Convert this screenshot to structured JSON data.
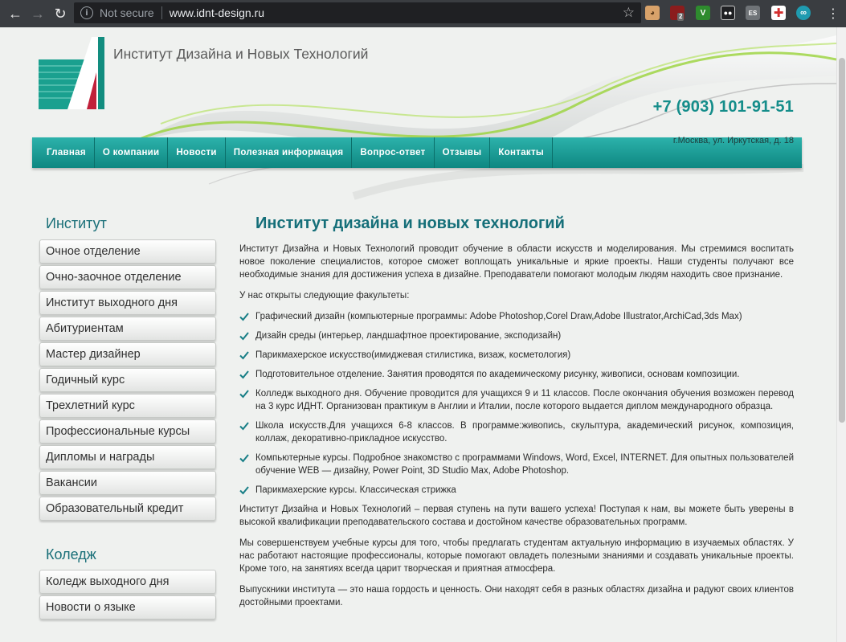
{
  "browser": {
    "security_label": "Not secure",
    "url": "www.idnt-design.ru",
    "badge_count": "2",
    "ext_v_label": "V",
    "ext_es_label": "ES"
  },
  "header": {
    "site_title": "Институт Дизайна и Новых Технологий",
    "phone": "+7 (903) 101-91-51",
    "address": "г.Москва, ул. Иркутская, д. 18"
  },
  "nav": {
    "items": [
      "Главная",
      "О компании",
      "Новости",
      "Полезная информация",
      "Вопрос-ответ",
      "Отзывы",
      "Контакты"
    ]
  },
  "sidebar": {
    "institute_heading": "Институт",
    "institute_items": [
      "Очное отделение",
      "Очно-заочное отделение",
      "Институт выходного дня",
      "Абитуриентам",
      "Мастер дизайнер",
      "Годичный курс",
      "Трехлетний курс",
      "Профессиональные курсы",
      "Дипломы и награды",
      "Вакансии",
      "Образовательный кредит"
    ],
    "college_heading": "Коледж",
    "college_items": [
      "Коледж выходного дня",
      "Новости о языке"
    ]
  },
  "content": {
    "title": "Институт дизайна и новых технологий",
    "intro": "Институт Дизайна и Новых Технологий проводит обучение в области искусств и моделирования. Мы стремимся воспитать новое поколение специалистов, которое сможет воплощать уникальные и яркие проекты. Наши студенты получают все необходимые знания для достижения успеха в дизайне. Преподаватели помогают молодым людям находить свое признание.",
    "faculties_intro": "У нас открыты следующие факультеты:",
    "faculties": [
      "Графический дизайн (компьютерные программы: Adobe Photoshop,Corel Draw,Adobe Illustrator,ArchiCad,3ds Max)",
      "Дизайн среды (интерьер, ландшафтное проектирование, эксподизайн)",
      "Парикмахерское искусство(имиджевая стилистика, визаж, косметология)",
      "Подготовительное отделение. Занятия проводятся по академическому рисунку, живописи, основам композиции.",
      "Колледж выходного дня. Обучение проводится для учащихся 9 и 11 классов. После окончания обучения возможен перевод на 3 курс ИДНТ. Организован практикум в Англии и Италии, после которого выдается диплом международного образца.",
      "Школа искусств.Для учащихся 6-8 классов. В программе:живопись, скульптура, академический рисунок, композиция, коллаж, декоративно-прикладное искусство.",
      "Компьютерные курсы. Подробное знакомство с программами Windows, Word, Excel, INTERNET. Для опытных пользователей обучение WEB — дизайну, Power Point, 3D Studio Max, Adobe Photoshop.",
      "Парикмахерские курсы. Классическая стрижка"
    ],
    "paragraph_1": "Институт Дизайна и Новых Технологий – первая ступень на пути вашего успеха! Поступая к нам, вы можете быть уверены в высокой квалификации преподавательского состава и достойном качестве образовательных программ.",
    "paragraph_2": "Мы совершенствуем учебные курсы для того, чтобы предлагать студентам актуальную информацию в изучаемых областях. У нас работают настоящие профессионалы, которые помогают овладеть полезными знаниями и создавать уникальные проекты. Кроме того, на занятиях всегда царит творческая и приятная атмосфера.",
    "paragraph_3": "Выпускники института — это наша гордость и ценность. Они находят себя в разных областях дизайна и радуют своих клиентов достойными проектами."
  },
  "colors": {
    "accent_teal": "#148d8a",
    "heading_teal": "#196f78",
    "nav_top": "#2cb2ab",
    "nav_bottom": "#0e8781"
  }
}
